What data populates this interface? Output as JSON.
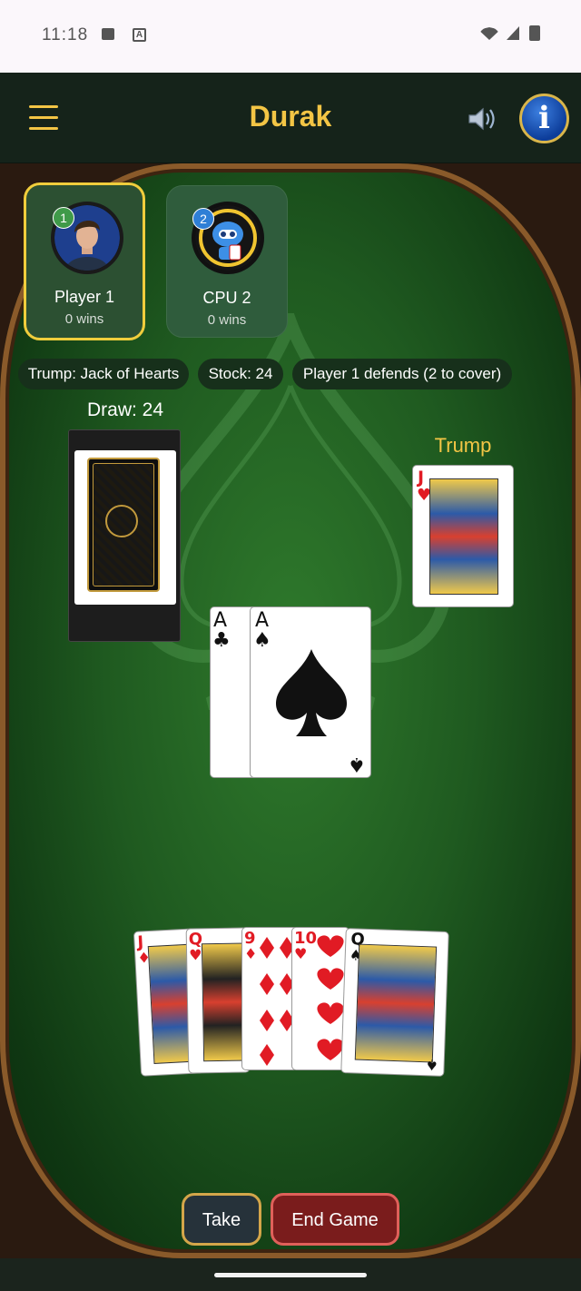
{
  "status_bar": {
    "time": "11:18",
    "icon_a": "A"
  },
  "header": {
    "title": "Durak",
    "menu_icon": "hamburger-icon",
    "sound_icon": "speaker-icon",
    "info_icon": "info-icon",
    "info_glyph": "i"
  },
  "players": [
    {
      "badge": "1",
      "name": "Player 1",
      "wins": "0 wins",
      "active": true
    },
    {
      "badge": "2",
      "name": "CPU 2",
      "wins": "0 wins",
      "active": false
    }
  ],
  "status_pills": {
    "trump": "Trump: Jack of Hearts",
    "stock": "Stock: 24",
    "phase": "Player 1 defends (2 to cover)"
  },
  "deck": {
    "label": "Draw: 24"
  },
  "trump_card": {
    "label": "Trump",
    "rank": "J",
    "suit": "♥"
  },
  "table_cards": [
    {
      "rank": "A",
      "suit": "♣"
    },
    {
      "rank": "A",
      "suit": "♠"
    }
  ],
  "hand": [
    {
      "rank": "J",
      "suit": "♦"
    },
    {
      "rank": "Q",
      "suit": "♥"
    },
    {
      "rank": "9",
      "suit": "♦"
    },
    {
      "rank": "10",
      "suit": "♥"
    },
    {
      "rank": "Q",
      "suit": "♠"
    }
  ],
  "actions": {
    "take": "Take",
    "end_game": "End Game"
  },
  "colors": {
    "accent": "#f3c545",
    "felt": "#1f5a20",
    "end_game": "#7a1c1c",
    "active_border": "#f0cd3c"
  }
}
